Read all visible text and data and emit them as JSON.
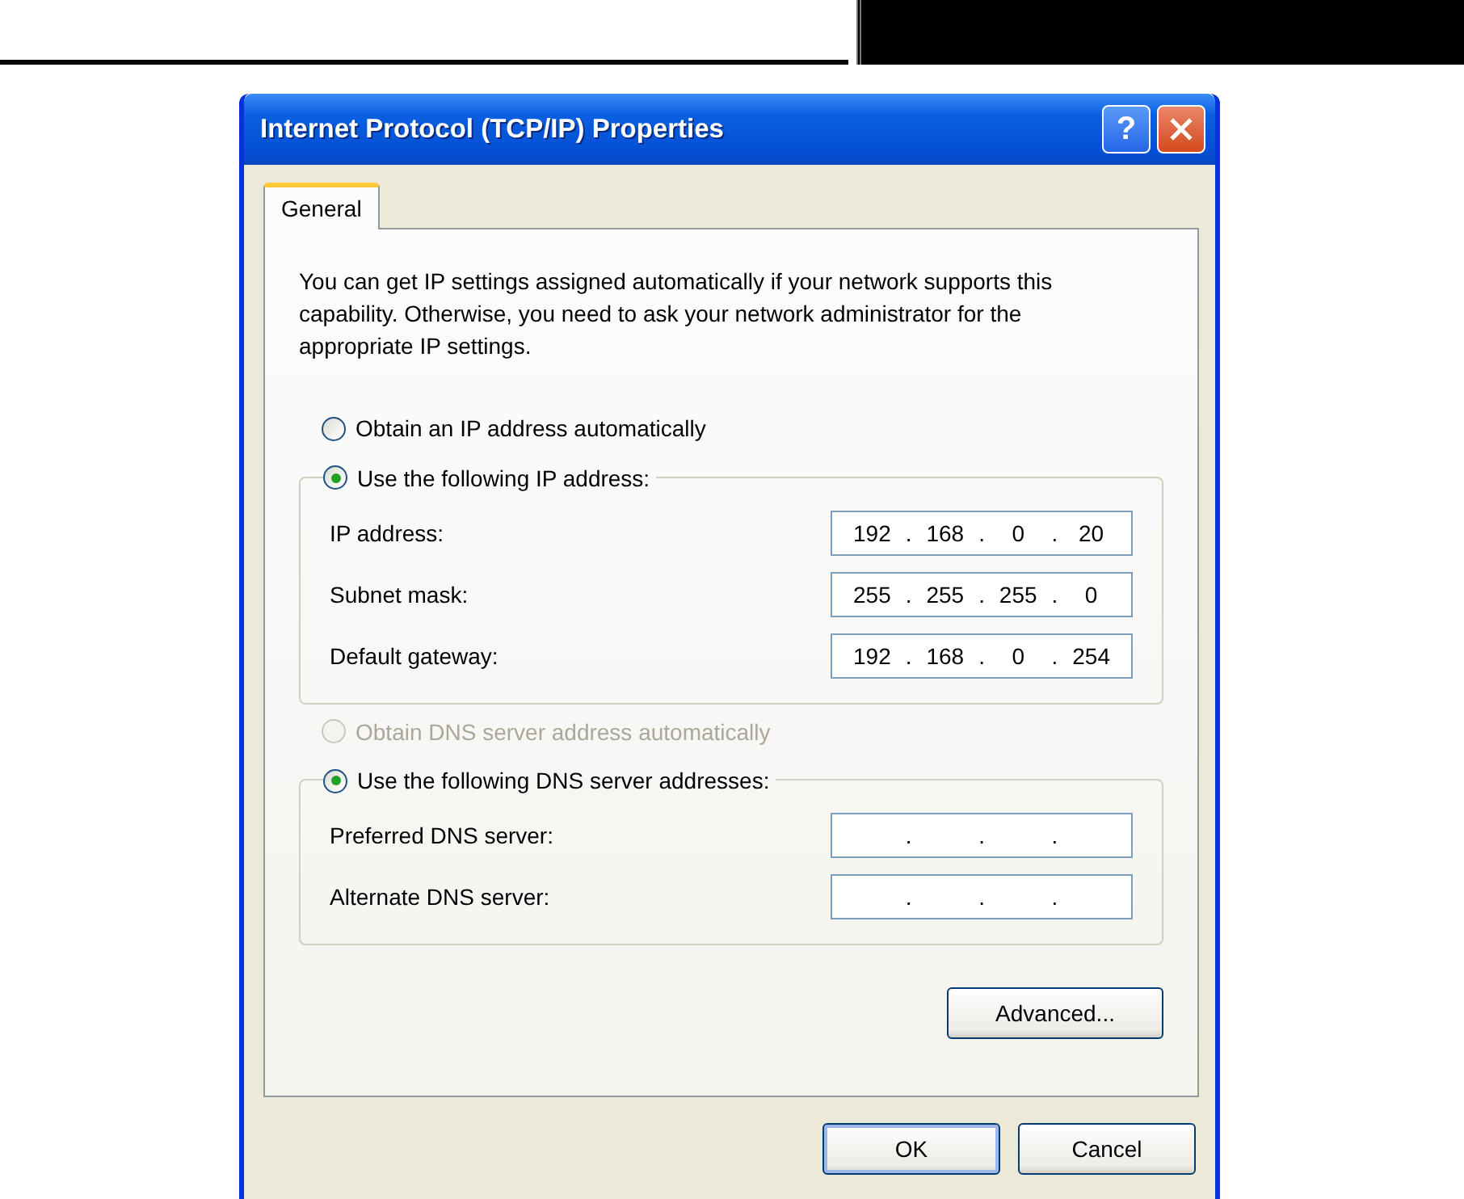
{
  "dialog": {
    "title": "Internet Protocol (TCP/IP) Properties",
    "help_button": "?"
  },
  "tabs": [
    {
      "label": "General",
      "selected": true
    }
  ],
  "description": "You can get IP settings assigned automatically if your network supports this capability. Otherwise, you need to ask your network administrator for the appropriate IP settings.",
  "sections": [
    {
      "kind": "radio",
      "label": "Obtain an IP address automatically",
      "selected": false,
      "disabled": false
    },
    {
      "kind": "group",
      "label": "Use the following IP address:",
      "selected": true,
      "disabled": false,
      "fields": [
        {
          "label": "IP address:",
          "separator": ".",
          "octets": [
            "192",
            "168",
            "0",
            "20"
          ]
        },
        {
          "label": "Subnet mask:",
          "separator": ".",
          "octets": [
            "255",
            "255",
            "255",
            "0"
          ]
        },
        {
          "label": "Default gateway:",
          "separator": ".",
          "octets": [
            "192",
            "168",
            "0",
            "254"
          ]
        }
      ]
    },
    {
      "kind": "radio",
      "label": "Obtain DNS server address automatically",
      "selected": false,
      "disabled": true
    },
    {
      "kind": "group",
      "label": "Use the following DNS server addresses:",
      "selected": true,
      "disabled": false,
      "fields": [
        {
          "label": "Preferred DNS server:",
          "separator": "."
        },
        {
          "label": "Alternate DNS server:",
          "separator": "."
        }
      ]
    }
  ],
  "advanced_button": "Advanced...",
  "buttons": [
    {
      "label": "OK",
      "default": true
    },
    {
      "label": "Cancel",
      "default": false
    }
  ]
}
